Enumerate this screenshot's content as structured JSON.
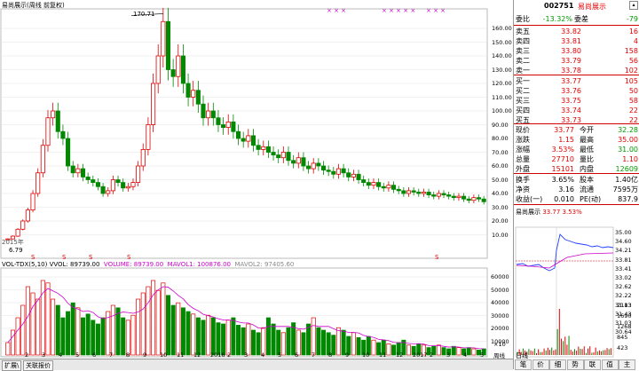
{
  "window": {
    "chart_title": "易尚展示(周线 前复权)",
    "peak_label": "170.71",
    "low_label": "6.79",
    "marker_s": "S",
    "year_label": "2015年",
    "magnets": [
      "× × ×",
      "× × × × ×",
      "× × ×",
      "× × ×"
    ]
  },
  "price_axis": [
    "160.00",
    "150.00",
    "140.00",
    "130.00",
    "120.00",
    "110.00",
    "100.00",
    "90.00",
    "80.00",
    "70.00",
    "60.00",
    "50.00",
    "40.00",
    "30.00",
    "20.00",
    "10.00"
  ],
  "volume_header": {
    "name": "VOL-TDX(5,10)",
    "vol": "VVOL: 89739.00",
    "volume": "VOLUME: 89739.00",
    "mavol1": "MAVOL1: 100876.00",
    "mavol2": "MAVOL2: 97405.60"
  },
  "volume_axis": [
    "60000",
    "50000",
    "40000",
    "30000",
    "20000",
    "10000"
  ],
  "volume_axis_unit": "×10",
  "week_label": "周线",
  "time_axis": [
    "2",
    "3",
    "4",
    "5",
    "6",
    "7",
    "8",
    "9",
    "10",
    "11",
    "12",
    "2016",
    "2",
    "3",
    "4",
    "5",
    "6",
    "7",
    "8",
    "9",
    "10",
    "11",
    "12",
    "2017",
    "2",
    "3",
    "4",
    "5"
  ],
  "bottom_tabs": [
    "扩展\\",
    "关联报价"
  ],
  "quote": {
    "code": "002751",
    "name": "易尚展示",
    "weibi_label": "委比",
    "weibi": "-13.32%",
    "weicha_label": "委差",
    "weicha": "-79",
    "asks": [
      {
        "label": "卖五",
        "price": "33.82",
        "vol": "16"
      },
      {
        "label": "卖四",
        "price": "33.81",
        "vol": "4"
      },
      {
        "label": "卖三",
        "price": "33.80",
        "vol": "158"
      },
      {
        "label": "卖二",
        "price": "33.79",
        "vol": "56"
      },
      {
        "label": "卖一",
        "price": "33.78",
        "vol": "102"
      }
    ],
    "bids": [
      {
        "label": "买一",
        "price": "33.77",
        "vol": "105"
      },
      {
        "label": "买二",
        "price": "33.76",
        "vol": "50"
      },
      {
        "label": "买三",
        "price": "33.75",
        "vol": "58"
      },
      {
        "label": "买四",
        "price": "33.74",
        "vol": "22"
      },
      {
        "label": "买五",
        "price": "33.73",
        "vol": "22"
      }
    ],
    "stats": [
      {
        "l1": "现价",
        "v1": "33.77",
        "c1": "red",
        "l2": "今开",
        "v2": "32.28",
        "c2": "green"
      },
      {
        "l1": "涨跌",
        "v1": "1.15",
        "c1": "red",
        "l2": "最高",
        "v2": "35.00",
        "c2": "red"
      },
      {
        "l1": "涨幅",
        "v1": "3.53%",
        "c1": "red",
        "l2": "最低",
        "v2": "31.00",
        "c2": "green"
      },
      {
        "l1": "总量",
        "v1": "27710",
        "c1": "red",
        "l2": "量比",
        "v2": "1.10",
        "c2": "red"
      },
      {
        "l1": "外盘",
        "v1": "15101",
        "c1": "red",
        "l2": "内盘",
        "v2": "12609",
        "c2": "green"
      }
    ],
    "stats2": [
      {
        "l1": "换手",
        "v1": "3.65%",
        "l2": "股本",
        "v2": "1.40亿"
      },
      {
        "l1": "净资",
        "v1": "3.16",
        "l2": "流通",
        "v2": "7595万"
      },
      {
        "l1": "收益(一)",
        "v1": "0.010",
        "l2": "PE(动)",
        "v2": "837.9"
      }
    ]
  },
  "intraday": {
    "name": "易尚展示",
    "price": "33.77",
    "pct": "3.53%",
    "axis": [
      "35.00",
      "34.60",
      "34.21",
      "33.81",
      "33.41",
      "33.02",
      "32.62",
      "32.22",
      "31.83",
      "31.43",
      "31.03",
      "30.64"
    ],
    "vol_axis": [
      "2113",
      "1690",
      "1268",
      "845",
      "423"
    ],
    "days_label": "日线"
  },
  "bottom_right_tabs": [
    "笔",
    "价",
    "细",
    "势",
    "联",
    "值",
    "主"
  ],
  "colors": {
    "up": "#e00000",
    "down": "#008800",
    "ma": "#cc00cc",
    "grid": "#c8c8c8"
  }
}
